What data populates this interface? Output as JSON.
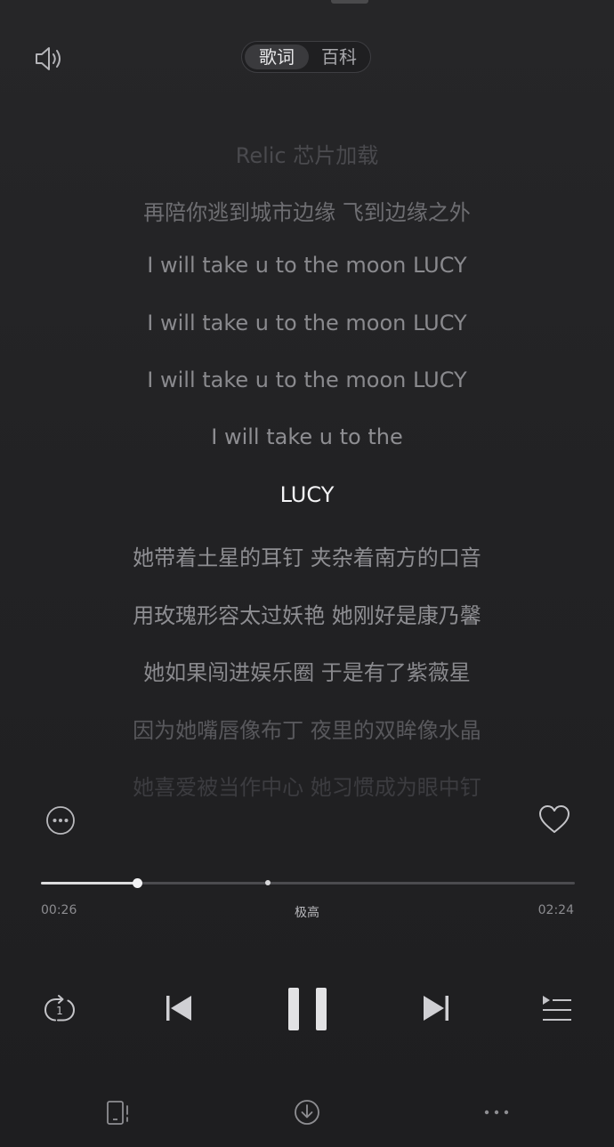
{
  "header": {
    "tabs": [
      {
        "label": "歌词",
        "active": true
      },
      {
        "label": "百科",
        "active": false
      }
    ],
    "icons": {
      "volume": "speaker-icon"
    }
  },
  "lyrics": {
    "lines": [
      "Relic 芯片加载",
      "再陪你逃到城市边缘 飞到边缘之外",
      "I will take u to the moon LUCY",
      "I will take u to the moon LUCY",
      "I will take u to the moon LUCY",
      "I will take u to the",
      "LUCY",
      "她带着土星的耳钉 夹杂着南方的口音",
      "用玫瑰形容太过妖艳 她刚好是康乃馨",
      "她如果闯进娱乐圈 于是有了紫薇星",
      "因为她嘴唇像布丁 夜里的双眸像水晶",
      "她喜爱被当作中心 她习惯成为眼中钉"
    ],
    "current_index": 6
  },
  "actions": {
    "more_icon": "more-circle-icon",
    "like_icon": "heart-icon"
  },
  "progress": {
    "current": "00:26",
    "total": "02:24",
    "quality": "极高",
    "fraction": 0.18
  },
  "controls": {
    "repeat_icon": "repeat-one-icon",
    "repeat_badge": "1",
    "prev_icon": "previous-icon",
    "play_state_icon": "pause-icon",
    "next_icon": "next-icon",
    "queue_icon": "playlist-icon"
  },
  "bottom": {
    "icons": [
      "device-icon",
      "download-icon",
      "more-horizontal-icon"
    ]
  },
  "colors": {
    "background": "#242426",
    "active_lyric": "#f4f4f6",
    "lyric": "#8a8a8e",
    "accent": "#dcdcde"
  }
}
